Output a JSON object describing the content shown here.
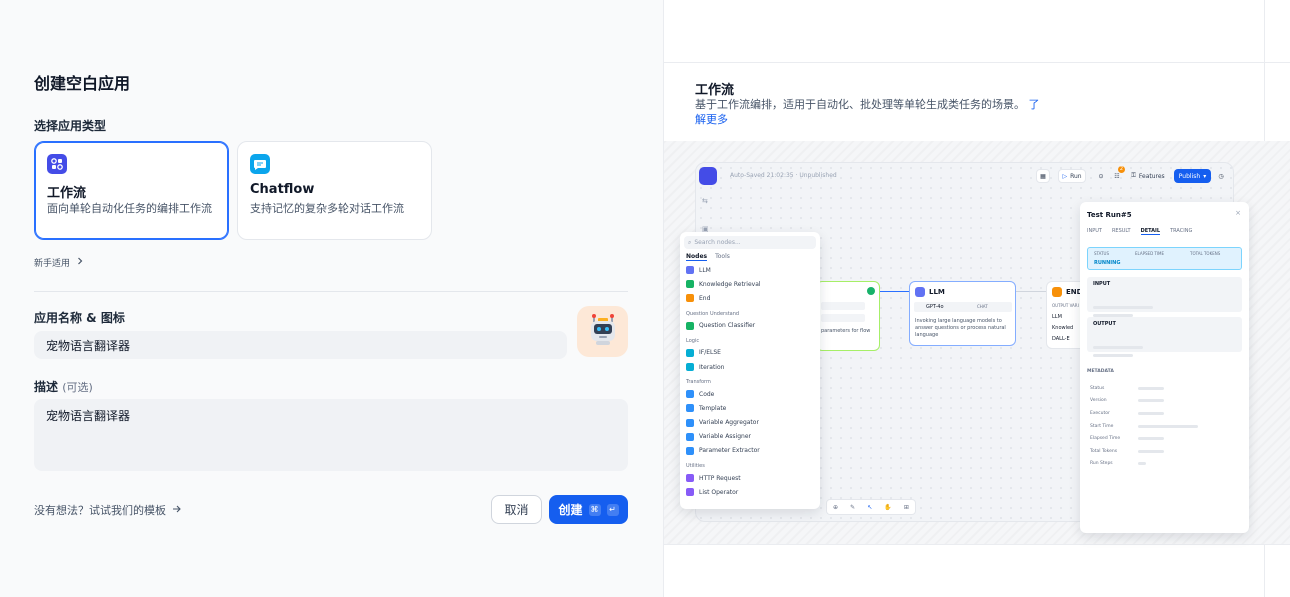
{
  "left": {
    "title": "创建空白应用",
    "select_type_label": "选择应用类型",
    "types": [
      {
        "name": "工作流",
        "desc": "面向单轮自动化任务的编排工作流",
        "icon": "workflow-icon",
        "color": "#444ce7"
      },
      {
        "name": "Chatflow",
        "desc": "支持记忆的复杂多轮对话工作流",
        "icon": "chatflow-icon",
        "color": "#0ba5ec"
      }
    ],
    "beginner_label": "新手适用",
    "name_label": "应用名称 & 图标",
    "name_value": "宠物语言翻译器",
    "desc_label": "描述",
    "desc_optional": "(可选)",
    "desc_value": "宠物语言翻译器",
    "template_link": "没有想法？试试我们的模板",
    "cancel_label": "取消",
    "create_label": "创建",
    "create_kbd1": "⌘",
    "create_kbd2": "↵"
  },
  "right": {
    "title": "工作流",
    "desc": "基于工作流编排，适用于自动化、批处理等单轮生成类任务的场景。",
    "more_link": "了解更多",
    "mock": {
      "autosave": "Auto-Saved 21:02:35 · Unpublished",
      "toolbar": {
        "run": "Run",
        "features": "Features",
        "publish": "Publish",
        "badge": "2"
      },
      "search_placeholder": "Search nodes...",
      "tabs": [
        "Nodes",
        "Tools"
      ],
      "node_groups": [
        {
          "category": "",
          "items": [
            {
              "label": "LLM",
              "color": "#6172f3"
            },
            {
              "label": "Knowledge Retrieval",
              "color": "#16b364"
            },
            {
              "label": "End",
              "color": "#f79009"
            }
          ]
        },
        {
          "category": "Question Understand",
          "items": [
            {
              "label": "Question Classifier",
              "color": "#16b364"
            }
          ]
        },
        {
          "category": "Logic",
          "items": [
            {
              "label": "IF/ELSE",
              "color": "#06aed4"
            },
            {
              "label": "Iteration",
              "color": "#06aed4"
            }
          ]
        },
        {
          "category": "Transform",
          "items": [
            {
              "label": "Code",
              "color": "#2e90fa"
            },
            {
              "label": "Template",
              "color": "#2e90fa"
            },
            {
              "label": "Variable Aggregator",
              "color": "#2e90fa"
            },
            {
              "label": "Variable Assigner",
              "color": "#2e90fa"
            },
            {
              "label": "Parameter Extractor",
              "color": "#2e90fa"
            }
          ]
        },
        {
          "category": "Utilities",
          "items": [
            {
              "label": "HTTP Request",
              "color": "#875bf7"
            },
            {
              "label": "List Operator",
              "color": "#875bf7"
            }
          ]
        }
      ],
      "start_node_text": "parameters for flow",
      "llm_node": {
        "title": "LLM",
        "model": "GPT-4o",
        "chat": "CHAT",
        "desc": "Invoking large language models to answer questions or process natural language"
      },
      "end_node": {
        "title": "END",
        "output_label": "OUTPUT VARI",
        "outputs": [
          "LLM",
          "Knowled",
          "DALL-E"
        ]
      },
      "run_panel": {
        "title": "Test Run#5",
        "tabs": [
          "INPUT",
          "RESULT",
          "DETAIL",
          "TRACING"
        ],
        "status_headers": [
          "STATUS",
          "ELAPSED TIME",
          "TOTAL TOKENS"
        ],
        "status_value": "RUNNING",
        "input_label": "INPUT",
        "output_label": "OUTPUT",
        "metadata_label": "METADATA",
        "metadata_rows": [
          "Status",
          "Version",
          "Executor",
          "Start Time",
          "Elapsed Time",
          "Total Tokens",
          "Run Steps"
        ]
      }
    }
  }
}
